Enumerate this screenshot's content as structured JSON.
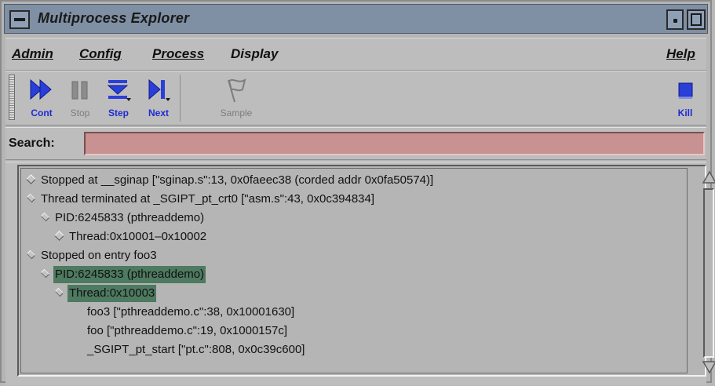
{
  "window": {
    "title": "Multiprocess Explorer"
  },
  "menubar": {
    "items": [
      {
        "label": "Admin",
        "mnemonic_index": 0
      },
      {
        "label": "Config",
        "mnemonic_index": 0
      },
      {
        "label": "Process",
        "mnemonic_index": 0
      },
      {
        "label": "Display",
        "mnemonic_index": -1
      }
    ],
    "help": {
      "label": "Help",
      "mnemonic_index": 0
    }
  },
  "toolbar": {
    "cont": {
      "label": "Cont",
      "icon": "continue-icon",
      "enabled": true
    },
    "stop": {
      "label": "Stop",
      "icon": "stop-icon",
      "enabled": false
    },
    "step": {
      "label": "Step",
      "icon": "step-into-icon",
      "enabled": true
    },
    "next": {
      "label": "Next",
      "icon": "step-over-icon",
      "enabled": true
    },
    "sample": {
      "label": "Sample",
      "icon": "flag-icon",
      "enabled": false
    },
    "kill": {
      "label": "Kill",
      "icon": "kill-icon",
      "enabled": true
    }
  },
  "search": {
    "label": "Search:",
    "value": "",
    "placeholder": ""
  },
  "tree": {
    "rows": [
      {
        "text": "Stopped at  __sginap [\"sginap.s\":13, 0x0faeec38 (corded addr 0x0fa50574)]",
        "level": 0,
        "node": "collapsed",
        "selected": false
      },
      {
        "text": "Thread terminated  at  _SGIPT_pt_crt0 [\"asm.s\":43, 0x0c394834]",
        "level": 0,
        "node": "expanded",
        "selected": false
      },
      {
        "text": "PID:6245833  (pthreaddemo)",
        "level": 1,
        "node": "expanded",
        "selected": false
      },
      {
        "text": "Thread:0x10001–0x10002",
        "level": 2,
        "node": "collapsed",
        "selected": false
      },
      {
        "text": "Stopped on entry foo3",
        "level": 0,
        "node": "expanded",
        "selected": false
      },
      {
        "text": "PID:6245833  (pthreaddemo)",
        "level": 1,
        "node": "expanded",
        "selected": true
      },
      {
        "text": "Thread:0x10003",
        "level": 2,
        "node": "expanded",
        "selected": true
      },
      {
        "text": "foo3 [\"pthreaddemo.c\":38, 0x10001630]",
        "level": 3,
        "node": "leaf",
        "selected": false
      },
      {
        "text": "foo [\"pthreaddemo.c\":19, 0x1000157c]",
        "level": 3,
        "node": "leaf",
        "selected": false
      },
      {
        "text": "_SGIPT_pt_start [\"pt.c\":808, 0x0c39c600]",
        "level": 3,
        "node": "leaf",
        "selected": false
      }
    ]
  },
  "colors": {
    "title_bar": "#7f8fa4",
    "active_tool_label": "#1f2bd0",
    "search_field": "#c99292",
    "selection": "#4d7a60"
  }
}
